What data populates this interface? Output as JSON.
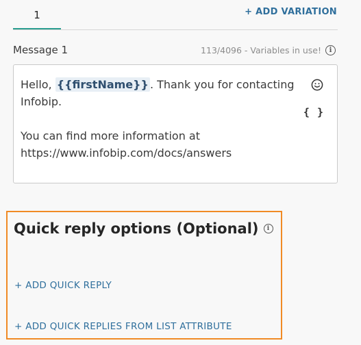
{
  "tabs": {
    "active_label": "1",
    "add_variation_label": "+ ADD VARIATION"
  },
  "message": {
    "label": "Message 1",
    "counter": "113/4096 - Variables in use!",
    "text_before_var": "Hello, ",
    "variable": "{{firstName}}",
    "text_after_var": ". Thank you for contacting Infobip.",
    "text_line2": "You can find more information at https://www.infobip.com/docs/answers",
    "braces_label": "{ }"
  },
  "quick_reply": {
    "title": "Quick reply options (Optional)",
    "add_quick_reply_label": "+ ADD QUICK REPLY",
    "add_from_list_label": "+ ADD QUICK REPLIES FROM LIST ATTRIBUTE"
  },
  "icons": {
    "info": "info-icon",
    "emoji": "smiley-icon",
    "variables": "braces-icon"
  },
  "colors": {
    "tab_active": "#2a9d8f",
    "link": "#2f6f9c",
    "highlight_border": "#f08a24",
    "variable_chip_bg": "#e8eff5"
  }
}
